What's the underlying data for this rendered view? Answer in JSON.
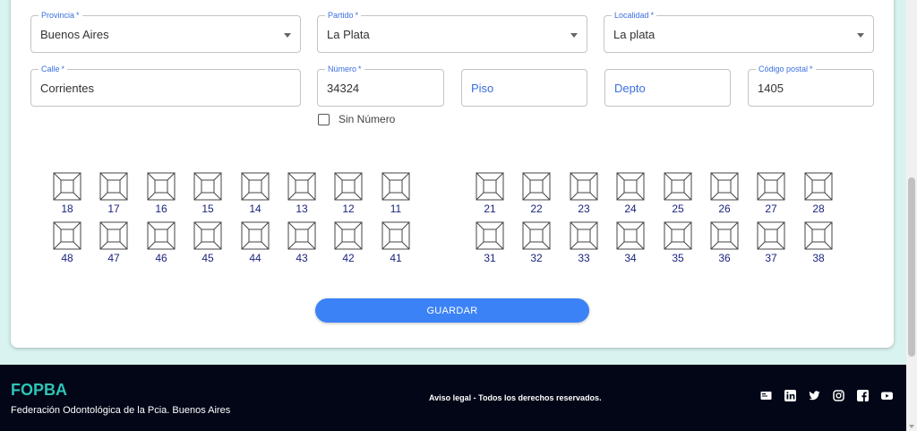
{
  "address": {
    "provincia": {
      "label": "Provincia",
      "value": "Buenos Aires"
    },
    "partido": {
      "label": "Partido",
      "value": "La Plata"
    },
    "localidad": {
      "label": "Localidad",
      "value": "La plata"
    },
    "calle": {
      "label": "Calle",
      "value": "Corrientes"
    },
    "numero": {
      "label": "Número",
      "value": "34324"
    },
    "piso": {
      "placeholder": "Piso"
    },
    "depto": {
      "placeholder": "Depto"
    },
    "codigo_postal": {
      "label": "Código postal",
      "value": "1405"
    },
    "required_mark": "*"
  },
  "sin_numero": {
    "label": "Sin Número",
    "checked": false
  },
  "teeth": {
    "upper_right": [
      "18",
      "17",
      "16",
      "15",
      "14",
      "13",
      "12",
      "11"
    ],
    "upper_left": [
      "21",
      "22",
      "23",
      "24",
      "25",
      "26",
      "27",
      "28"
    ],
    "lower_right": [
      "48",
      "47",
      "46",
      "45",
      "44",
      "43",
      "42",
      "41"
    ],
    "lower_left": [
      "31",
      "32",
      "33",
      "34",
      "35",
      "36",
      "37",
      "38"
    ]
  },
  "actions": {
    "save_label": "GUARDAR"
  },
  "colors": {
    "accent": "#3b82f6",
    "brand": "#2ec4b6",
    "footer_bg": "#020617",
    "tooth_number": "#1a237e"
  },
  "footer": {
    "brand": "FOPBA",
    "subtitle": "Federación Odontológica de la Pcia. Buenos Aires",
    "legal": "Aviso legal - Todos los derechos reservados.",
    "social_icons": [
      "id-card-icon",
      "linkedin-icon",
      "twitter-icon",
      "instagram-icon",
      "facebook-icon",
      "youtube-icon"
    ]
  }
}
